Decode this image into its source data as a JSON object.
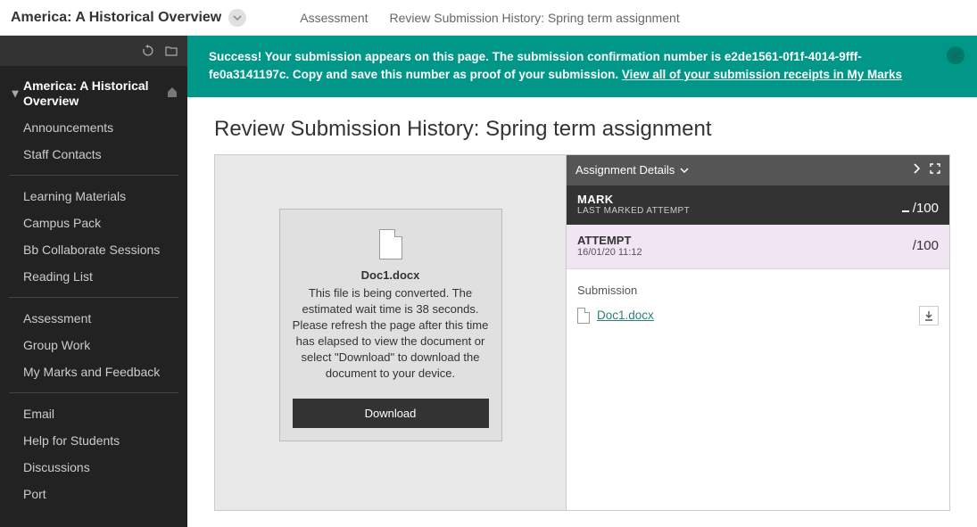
{
  "header": {
    "course_title": "America: A Historical Overview",
    "breadcrumb": [
      "Assessment",
      "Review Submission History: Spring term assignment"
    ]
  },
  "sidebar": {
    "root_label": "America: A Historical Overview",
    "groups": [
      {
        "items": [
          "Announcements",
          "Staff Contacts"
        ]
      },
      {
        "items": [
          "Learning Materials",
          "Campus Pack",
          "Bb Collaborate Sessions",
          "Reading List"
        ]
      },
      {
        "items": [
          "Assessment",
          "Group Work",
          "My Marks and Feedback"
        ]
      },
      {
        "items": [
          "Email",
          "Help for Students",
          "Discussions",
          "Port"
        ]
      }
    ]
  },
  "banner": {
    "text_prefix": "Success! Your submission appears on this page. The submission confirmation number is ",
    "confirmation": "e2de1561-0f1f-4014-9fff-fe0a3141197c",
    "text_suffix": ". Copy and save this number as proof of your submission. ",
    "link_label": "View all of your submission receipts in My Marks"
  },
  "page": {
    "title": "Review Submission History: Spring term assignment"
  },
  "preview": {
    "file_name": "Doc1.docx",
    "message": "This file is being converted. The estimated wait time is 38 seconds. Please refresh the page after this time has elapsed to view the document or select \"Download\" to download the document to your device.",
    "download_label": "Download"
  },
  "details": {
    "header_label": "Assignment Details",
    "mark": {
      "title": "MARK",
      "subtitle": "LAST MARKED ATTEMPT",
      "out_of": "/100"
    },
    "attempt": {
      "title": "ATTEMPT",
      "timestamp": "16/01/20 11:12",
      "out_of": "/100"
    },
    "submission": {
      "label": "Submission",
      "file_name": "Doc1.docx"
    }
  }
}
